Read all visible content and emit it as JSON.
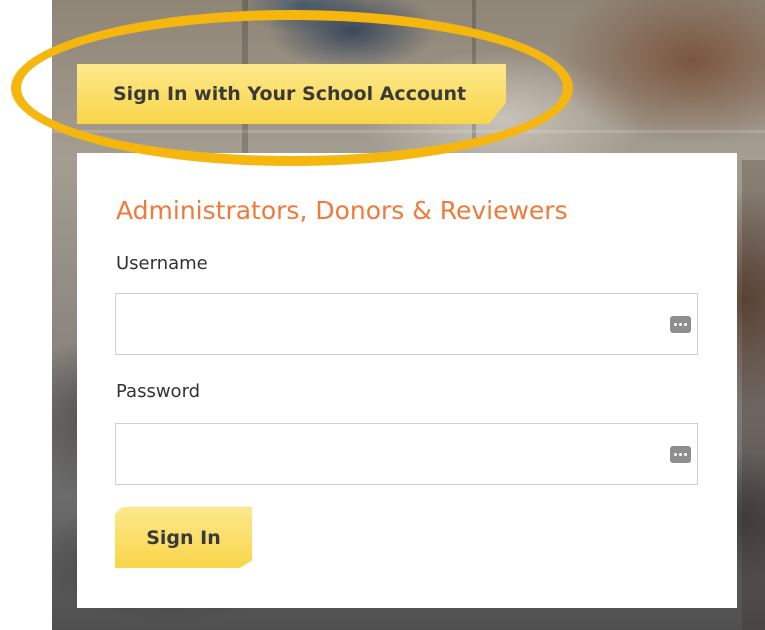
{
  "school_account": {
    "button_label": "Sign In with Your School Account"
  },
  "login_form": {
    "heading": "Administrators, Donors & Reviewers",
    "username_label": "Username",
    "username_value": "",
    "password_label": "Password",
    "password_value": "",
    "submit_label": "Sign In"
  },
  "icons": {
    "username_field_icon": "password-manager-icon",
    "password_field_icon": "password-manager-icon"
  },
  "colors": {
    "accent_yellow": "#f9d54a",
    "highlight_ring": "#f5b70e",
    "heading_orange": "#f07a3a"
  }
}
